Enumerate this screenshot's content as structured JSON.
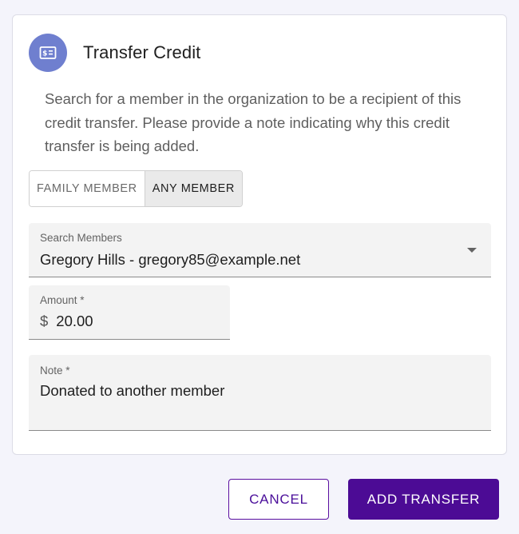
{
  "dialog": {
    "title": "Transfer Credit",
    "description": "Search for a member in the organization to be a recipient of this credit transfer. Please provide a note indicating why this credit transfer is being added.",
    "icon": "credit-card-dollar-icon",
    "accent": "#6f7fcf"
  },
  "toggle": {
    "options": [
      "FAMILY MEMBER",
      "ANY MEMBER"
    ],
    "selected": "ANY MEMBER"
  },
  "search": {
    "label": "Search Members",
    "value": "Gregory Hills - gregory85@example.net"
  },
  "amount": {
    "label": "Amount *",
    "prefix": "$",
    "value": "20.00"
  },
  "note": {
    "label": "Note *",
    "value": "Donated to another member"
  },
  "actions": {
    "cancel_label": "CANCEL",
    "add_label": "ADD TRANSFER",
    "primary_color": "#4c0b95"
  }
}
